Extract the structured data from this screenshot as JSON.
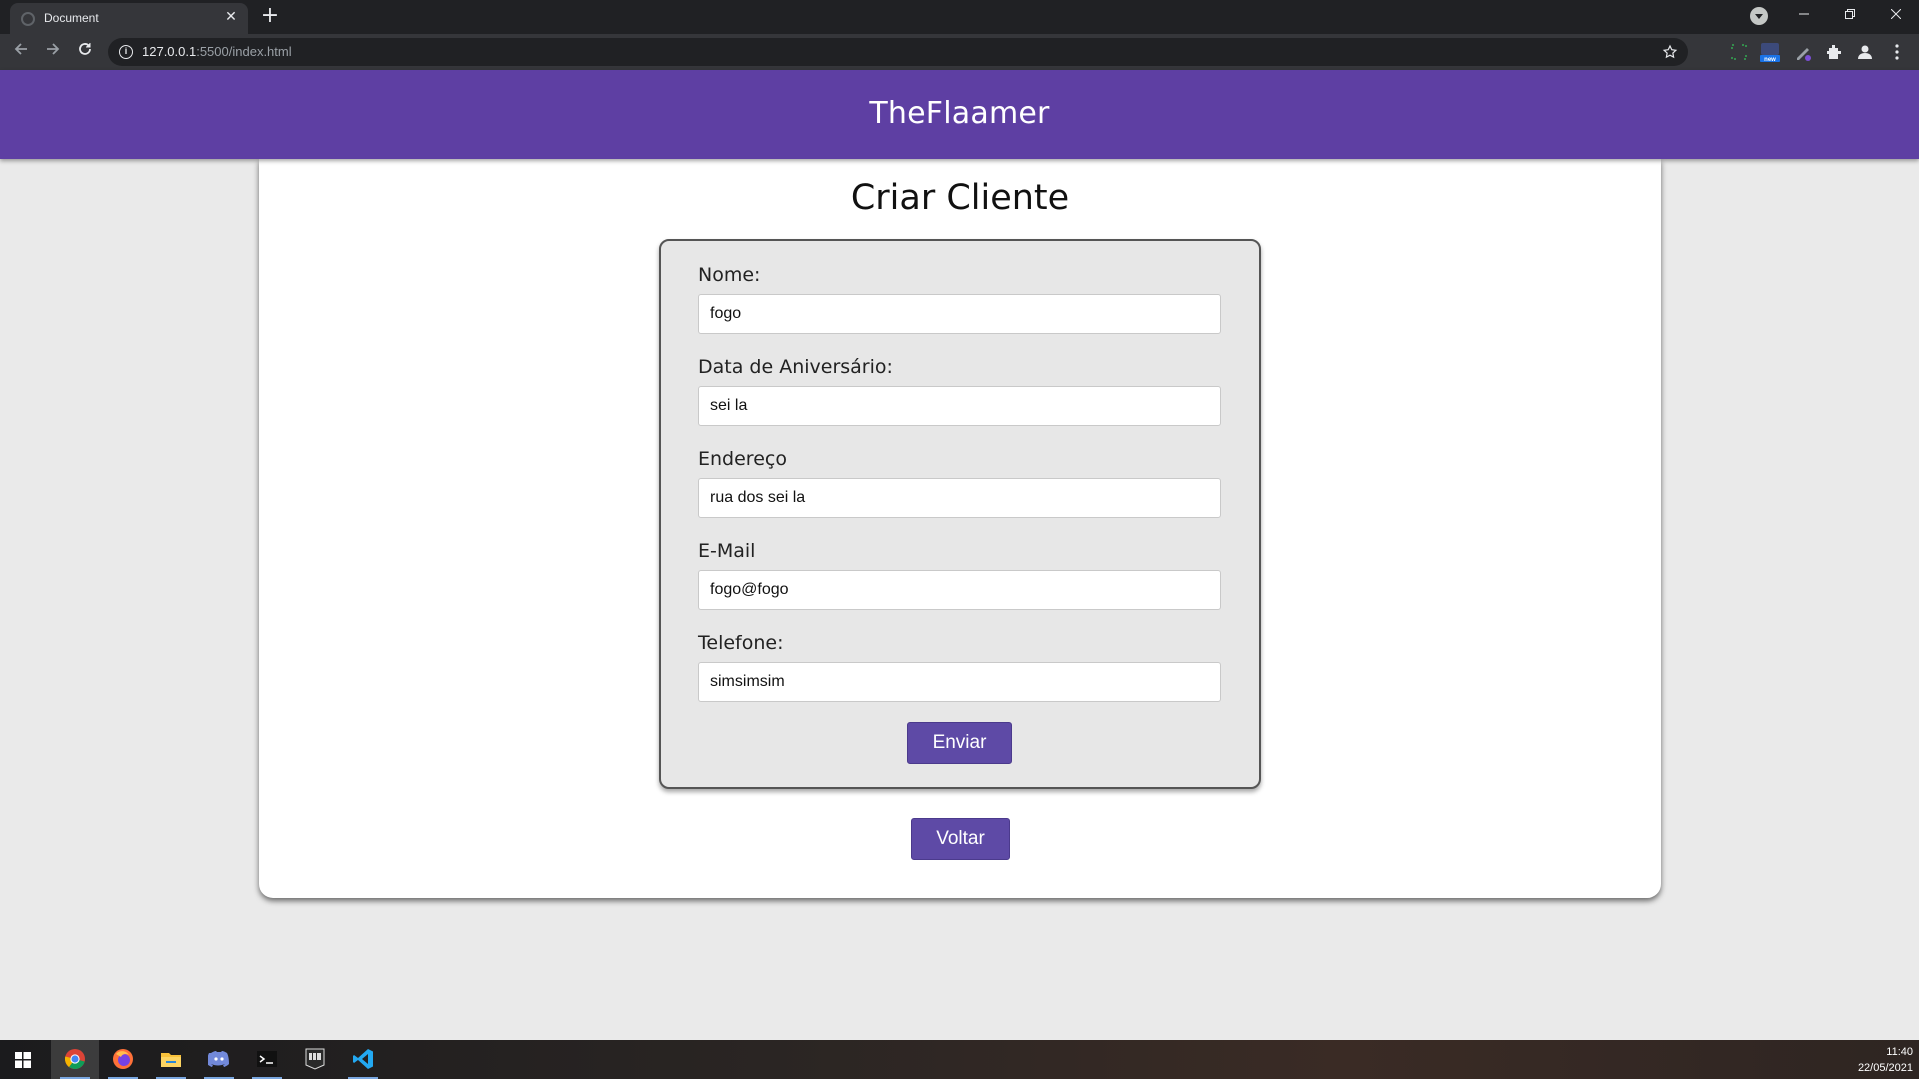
{
  "browser": {
    "tab_title": "Document",
    "tab_close": "✕",
    "new_tab": "+",
    "url_host": "127.0.0.1",
    "url_rest": ":5500/index.html",
    "info_glyph": "i",
    "icons": [
      "back-icon",
      "forward-icon",
      "reload-icon",
      "info-icon",
      "star-icon",
      "extensions-icon",
      "profile-icon",
      "menu-icon"
    ]
  },
  "site": {
    "brand": "TheFlaamer",
    "header_color": "#5e3fa3"
  },
  "page": {
    "title": "Criar Cliente"
  },
  "form": {
    "fields": [
      {
        "label": "Nome:",
        "value": "fogo"
      },
      {
        "label": "Data de Aniversário:",
        "value": "sei la"
      },
      {
        "label": "Endereço",
        "value": "rua dos sei la"
      },
      {
        "label": "E-Mail",
        "value": "fogo@fogo"
      },
      {
        "label": "Telefone:",
        "value": "simsimsim"
      }
    ],
    "submit_label": "Enviar"
  },
  "back_label": "Voltar",
  "button_color": "#5e4aa6",
  "taskbar": {
    "time": "11:40",
    "date": "22/05/2021",
    "apps": [
      "chrome-icon",
      "firefox-icon",
      "file-explorer-icon",
      "discord-icon",
      "terminal-icon",
      "epic-games-icon",
      "vscode-icon"
    ]
  }
}
